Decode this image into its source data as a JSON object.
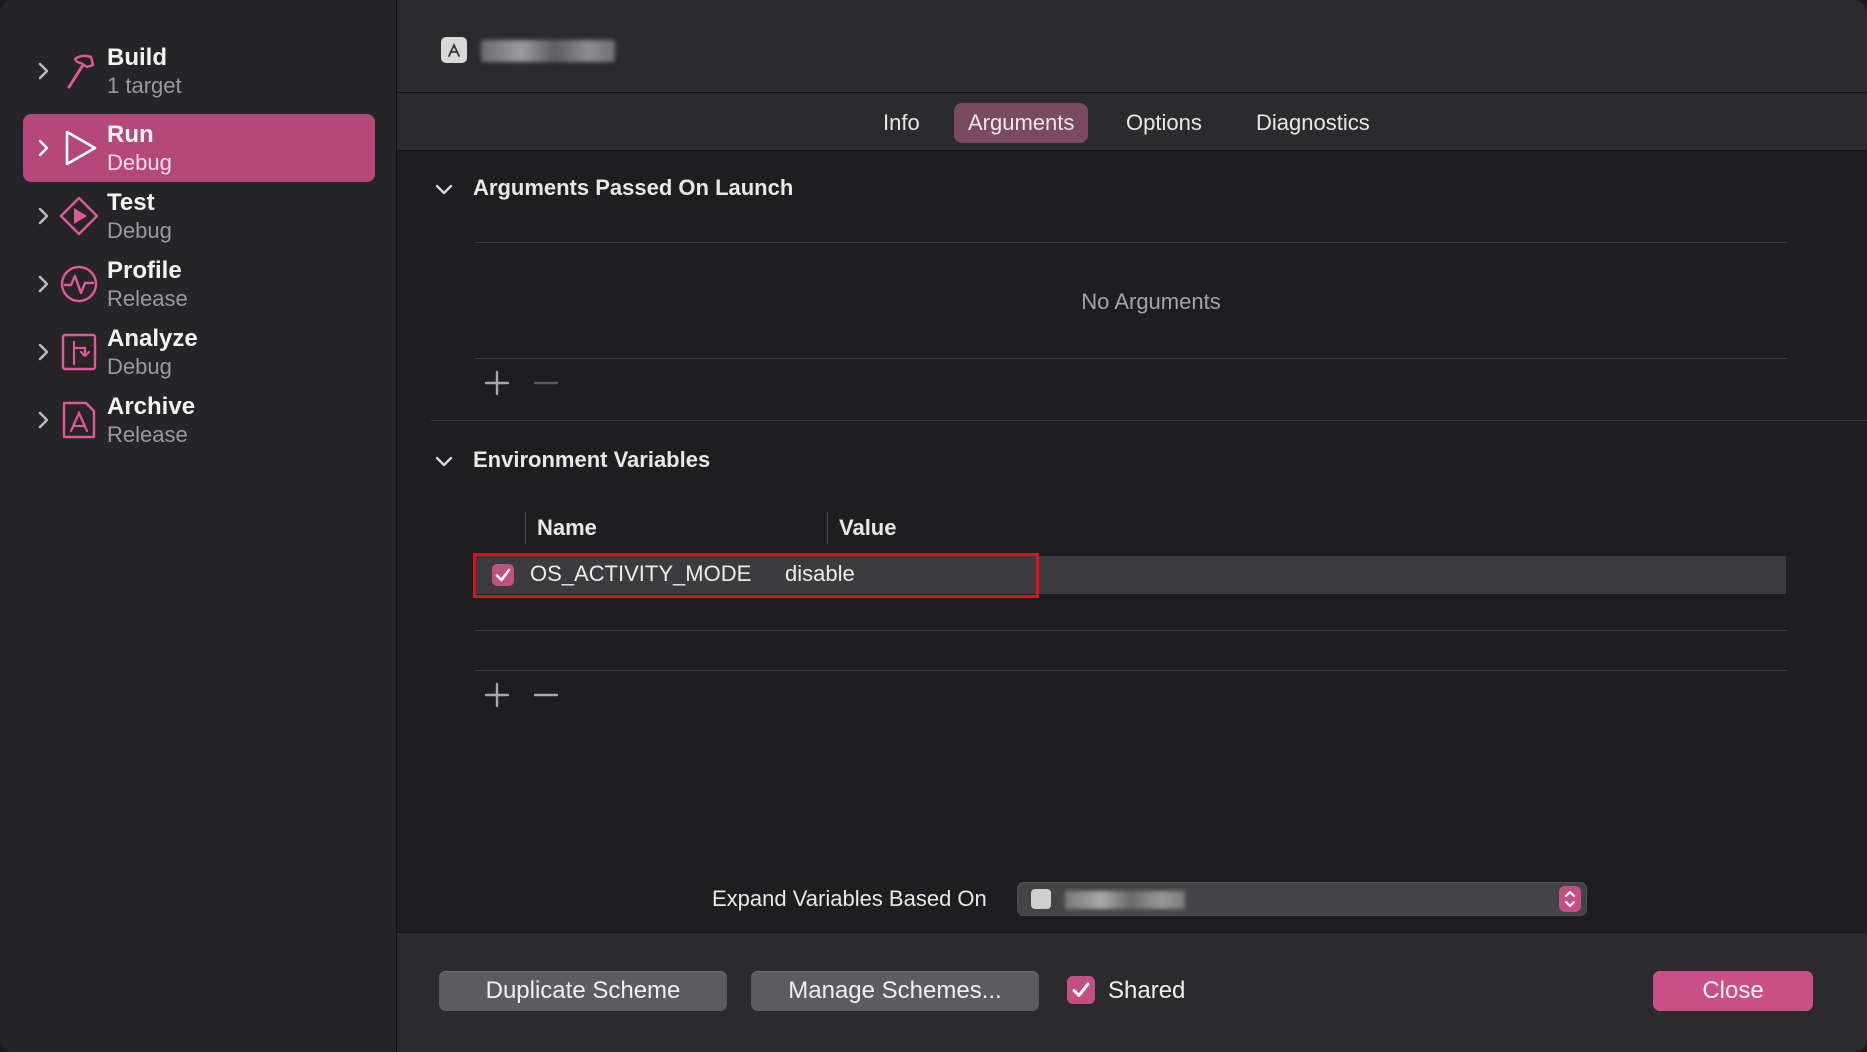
{
  "sidebar": {
    "items": [
      {
        "title": "Build",
        "subtitle": "1 target",
        "icon": "hammer-icon",
        "selected": false
      },
      {
        "title": "Run",
        "subtitle": "Debug",
        "icon": "play-icon",
        "selected": true
      },
      {
        "title": "Test",
        "subtitle": "Debug",
        "icon": "test-diamond-icon",
        "selected": false
      },
      {
        "title": "Profile",
        "subtitle": "Release",
        "icon": "profile-waveform-icon",
        "selected": false
      },
      {
        "title": "Analyze",
        "subtitle": "Debug",
        "icon": "analyze-icon",
        "selected": false
      },
      {
        "title": "Archive",
        "subtitle": "Release",
        "icon": "archive-icon",
        "selected": false
      }
    ]
  },
  "header": {
    "app_icon": "app-store-icon"
  },
  "tabs": [
    {
      "label": "Info",
      "active": false
    },
    {
      "label": "Arguments",
      "active": true
    },
    {
      "label": "Options",
      "active": false
    },
    {
      "label": "Diagnostics",
      "active": false
    }
  ],
  "arguments_section": {
    "title": "Arguments Passed On Launch",
    "empty_text": "No Arguments"
  },
  "env_section": {
    "title": "Environment Variables",
    "columns": [
      "Name",
      "Value"
    ],
    "rows": [
      {
        "enabled": true,
        "name": "OS_ACTIVITY_MODE",
        "value": "disable"
      }
    ]
  },
  "expand": {
    "label": "Expand Variables Based On"
  },
  "footer": {
    "duplicate_label": "Duplicate Scheme",
    "manage_label": "Manage Schemes...",
    "shared_label": "Shared",
    "shared_checked": true,
    "close_label": "Close"
  },
  "colors": {
    "accent": "#c44f85",
    "sidebar_selected": "#b5487a",
    "highlight_border": "#e0101c"
  }
}
